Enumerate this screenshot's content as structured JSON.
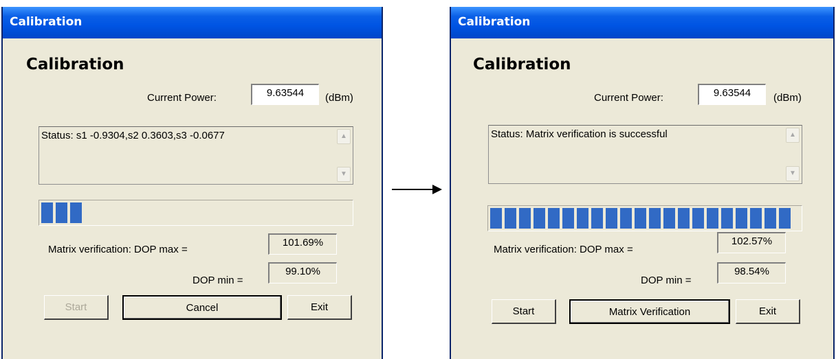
{
  "left": {
    "title": "Calibration",
    "heading": "Calibration",
    "current_power_label": "Current Power:",
    "current_power_value": "9.63544",
    "unit": "(dBm)",
    "status_text": "Status: s1 -0.9304,s2 0.3603,s3 -0.0677",
    "progress": {
      "filled_segments": 3,
      "total_segments": 21
    },
    "dop_max_label": "Matrix verification: DOP max =",
    "dop_max_value": "101.69%",
    "dop_min_label": "DOP min =",
    "dop_min_value": "99.10%",
    "buttons": {
      "start": "Start",
      "middle": "Cancel",
      "exit": "Exit"
    },
    "start_disabled": true
  },
  "right": {
    "title": "Calibration",
    "heading": "Calibration",
    "current_power_label": "Current Power:",
    "current_power_value": "9.63544",
    "unit": "(dBm)",
    "status_text": "Status: Matrix verification is successful",
    "progress": {
      "filled_segments": 21,
      "total_segments": 21
    },
    "dop_max_label": "Matrix verification: DOP max =",
    "dop_max_value": "102.57%",
    "dop_min_label": "DOP min =",
    "dop_min_value": "98.54%",
    "buttons": {
      "start": "Start",
      "middle": "Matrix Verification",
      "exit": "Exit"
    },
    "start_disabled": false
  },
  "icons": {
    "scroll_up": "chevron-up-icon",
    "scroll_down": "chevron-down-icon",
    "transition": "arrow-right-icon"
  },
  "colors": {
    "titlebar": "#0054e3",
    "dialog_bg": "#ece9d8",
    "progress_fill": "#316ac5"
  }
}
